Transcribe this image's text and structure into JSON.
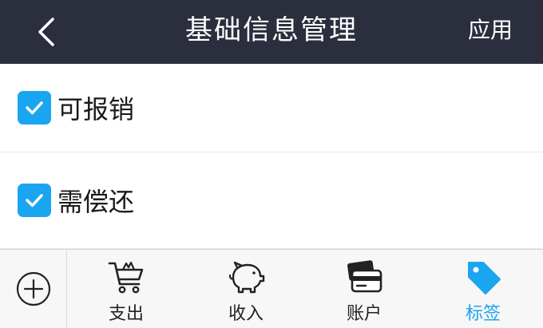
{
  "header": {
    "title": "基础信息管理",
    "back_icon": "chevron-left-icon",
    "apply_label": "应用"
  },
  "options": [
    {
      "label": "可报销",
      "checked": true
    },
    {
      "label": "需偿还",
      "checked": true
    }
  ],
  "tabbar": {
    "add_icon": "plus-circle-icon",
    "tabs": [
      {
        "label": "支出",
        "icon": "shopping-cart-icon",
        "active": false
      },
      {
        "label": "收入",
        "icon": "piggy-bank-icon",
        "active": false
      },
      {
        "label": "账户",
        "icon": "wallet-card-icon",
        "active": false
      },
      {
        "label": "标签",
        "icon": "tag-icon",
        "active": true
      }
    ]
  },
  "colors": {
    "header_bg": "#2b2e3d",
    "accent": "#1aa5f0",
    "tabbar_bg": "#f7f7f7"
  }
}
